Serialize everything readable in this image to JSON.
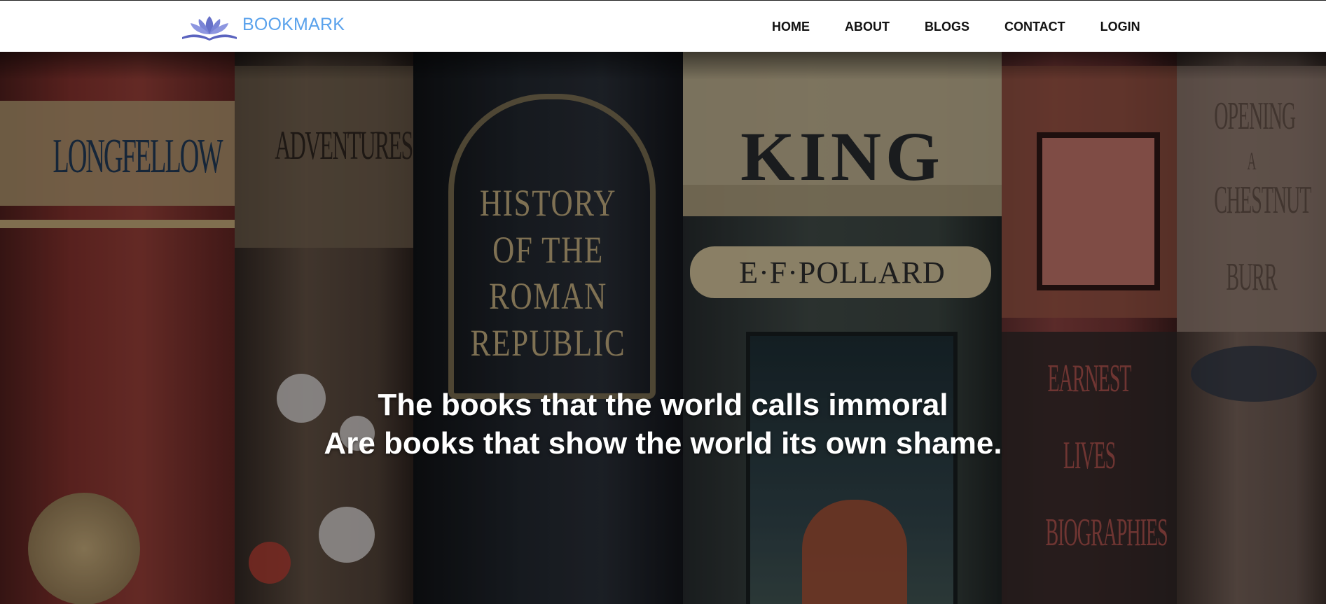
{
  "brand": {
    "name": "BOOKMARK",
    "logo_icon": "lotus-book-icon",
    "color": "#5aa2ec"
  },
  "nav": {
    "links": [
      "HOME",
      "ABOUT",
      "BLOGS",
      "CONTACT",
      "LOGIN"
    ]
  },
  "hero": {
    "quote_line1": "The books that the world calls immoral",
    "quote_line2": "Are books that show the world its own shame.",
    "spines": {
      "longfellow": "LONGFELLOW",
      "adventures": "ADVENTURES",
      "history": [
        "HISTORY",
        "OF THE",
        "ROMAN",
        "REPUBLIC"
      ],
      "king": "KING",
      "pollard": "E·F·POLLARD",
      "earnest": [
        "EARNEST",
        "LIVES",
        "BIOGRAPHIES"
      ],
      "chestnut": [
        "OPENING",
        "A",
        "CHESTNUT",
        "BURR"
      ]
    }
  }
}
